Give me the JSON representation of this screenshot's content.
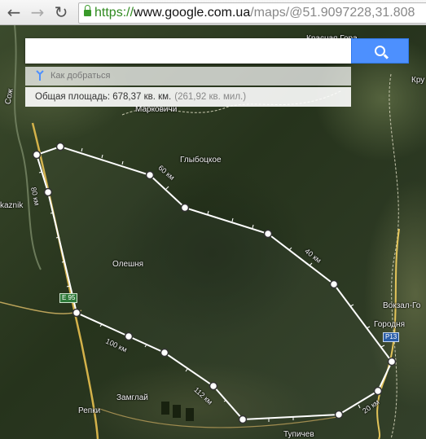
{
  "browser": {
    "back_icon": "arrow-left",
    "forward_icon": "arrow-right",
    "reload_icon": "reload",
    "url_scheme": "https://",
    "url_host": "www.google.com.ua",
    "url_path": "/maps/@51.9097228,31.808"
  },
  "search": {
    "value": "",
    "placeholder": "",
    "button_icon": "search-icon",
    "button_color": "#4d90fe"
  },
  "directions": {
    "label": "Как добраться"
  },
  "area": {
    "metric": "Общая площадь: 678,37 кв. км.",
    "imperial": "(261,92 кв. мил.)"
  },
  "map": {
    "place_labels": {
      "marcovichi": "Марковичи",
      "glybotskoe": "Глыбоцкое",
      "oleshnia": "Олешня",
      "gorodnia": "Городня",
      "vokzal": "Вокзал-Го",
      "zamglai": "Замглай",
      "repki": "Репки",
      "tupichev": "Тупичев",
      "kru": "Кру",
      "krasnaya": "Красная Гора",
      "sozh": "Сож",
      "kaznik": "kaznik"
    },
    "road_labels": {
      "e95": "E 95",
      "p13": "P13"
    },
    "distance_labels": {
      "d60": "60 км",
      "d40": "40 км",
      "d80": "80 км",
      "d100": "100 км",
      "d112": "112 км",
      "d20": "20 км"
    },
    "polygon_color": "#ffffff"
  }
}
